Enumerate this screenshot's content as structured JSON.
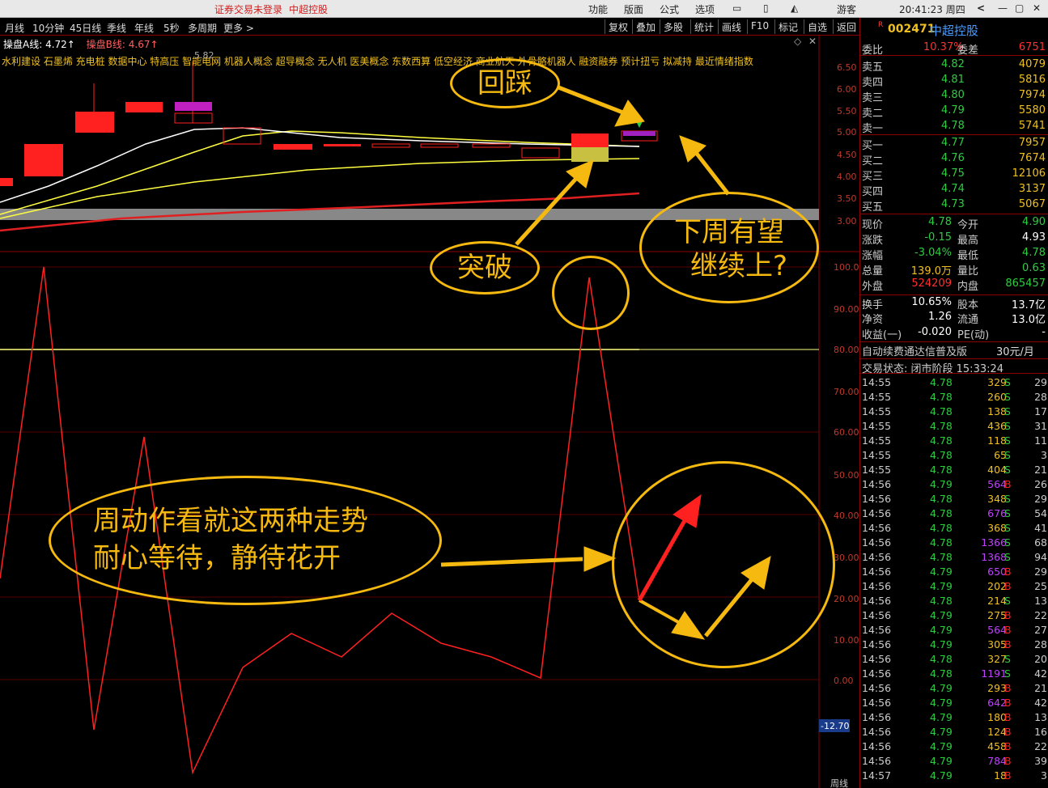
{
  "titlebar": {
    "status": "证券交易未登录",
    "stock_name": "中超控股",
    "menu": [
      "功能",
      "版面",
      "公式",
      "选项"
    ],
    "guest": "游客",
    "clock": "20:41:23 周四"
  },
  "toolbar": {
    "periods": [
      "月线",
      "10分钟",
      "45日线",
      "季线",
      "年线",
      "5秒",
      "多周期",
      "更多 >"
    ],
    "right_buttons": [
      "复权",
      "叠加",
      "多股",
      "统计",
      "画线",
      "F10",
      "标记",
      "自选",
      "返回"
    ]
  },
  "indicator_header": {
    "line_a": "操盘A线: 4.72↑",
    "line_b": "操盘B线: 4.67↑",
    "concepts": "水利建设 石墨烯 充电桩 数据中心 特高压 智能电网 机器人概念 超导概念 无人机 医美概念 东数西算 低空经济 商业航天 外骨骼机器人 融资融券 预计扭亏 拟减持 最近情绪指数",
    "price_tag": "5.82"
  },
  "price_axis": [
    "6.50",
    "6.00",
    "5.50",
    "5.00",
    "4.50",
    "4.00",
    "3.50",
    "3.00"
  ],
  "osc_axis": [
    "100.0",
    "90.00",
    "80.00",
    "70.00",
    "60.00",
    "50.00",
    "40.00",
    "30.00",
    "20.00",
    "10.00",
    "0.00"
  ],
  "osc_current": "-12.70",
  "corner_label": "周线",
  "annotations": {
    "huicai": "回踩",
    "tupo": "突破",
    "next_week_1": "下周有望",
    "next_week_2": "继续上?",
    "bottom_1": "周动作看就这两种走势",
    "bottom_2": "耐心等待，静待花开"
  },
  "quote": {
    "code": "002471",
    "name": "中超控股",
    "weibi_label": "委比",
    "weibi": "10.37%",
    "weicha_label": "委差",
    "weicha": "6751",
    "asks": [
      {
        "label": "卖五",
        "price": "4.82",
        "vol": "4079"
      },
      {
        "label": "卖四",
        "price": "4.81",
        "vol": "5816"
      },
      {
        "label": "卖三",
        "price": "4.80",
        "vol": "7974"
      },
      {
        "label": "卖二",
        "price": "4.79",
        "vol": "5580"
      },
      {
        "label": "卖一",
        "price": "4.78",
        "vol": "5741"
      }
    ],
    "bids": [
      {
        "label": "买一",
        "price": "4.77",
        "vol": "7957"
      },
      {
        "label": "买二",
        "price": "4.76",
        "vol": "7674"
      },
      {
        "label": "买三",
        "price": "4.75",
        "vol": "12106"
      },
      {
        "label": "买四",
        "price": "4.74",
        "vol": "3137"
      },
      {
        "label": "买五",
        "price": "4.73",
        "vol": "5067"
      }
    ],
    "stats": [
      {
        "l1": "现价",
        "v1": "4.78",
        "c1": "#2ecc40",
        "l2": "今开",
        "v2": "4.90",
        "c2": "#2ecc40"
      },
      {
        "l1": "涨跌",
        "v1": "-0.15",
        "c1": "#2ecc40",
        "l2": "最高",
        "v2": "4.93",
        "c2": "#ffffff"
      },
      {
        "l1": "涨幅",
        "v1": "-3.04%",
        "c1": "#2ecc40",
        "l2": "最低",
        "v2": "4.78",
        "c2": "#2ecc40"
      },
      {
        "l1": "总量",
        "v1": "139.0万",
        "c1": "#f0c020",
        "l2": "量比",
        "v2": "0.63",
        "c2": "#2ecc40"
      },
      {
        "l1": "外盘",
        "v1": "524209",
        "c1": "#ff3030",
        "l2": "内盘",
        "v2": "865457",
        "c2": "#2ecc40"
      },
      {
        "l1": "换手",
        "v1": "10.65%",
        "c1": "#ffffff",
        "l2": "股本",
        "v2": "13.7亿",
        "c2": "#ffffff"
      },
      {
        "l1": "净资",
        "v1": "1.26",
        "c1": "#ffffff",
        "l2": "流通",
        "v2": "13.0亿",
        "c2": "#ffffff"
      },
      {
        "l1": "收益(一)",
        "v1": "-0.020",
        "c1": "#ffffff",
        "l2": "PE(动)",
        "v2": "-",
        "c2": "#ffffff"
      }
    ],
    "banner": "自动续费通达信普及版",
    "banner_price": "30元/月",
    "trade_state": "交易状态: 闭市阶段 15:33:24",
    "ticks": [
      [
        "14:55",
        "4.78",
        "329",
        "S",
        "29"
      ],
      [
        "14:55",
        "4.78",
        "260",
        "S",
        "28"
      ],
      [
        "14:55",
        "4.78",
        "138",
        "S",
        "17"
      ],
      [
        "14:55",
        "4.78",
        "436",
        "S",
        "31"
      ],
      [
        "14:55",
        "4.78",
        "118",
        "S",
        "11"
      ],
      [
        "14:55",
        "4.78",
        "65",
        "S",
        "3"
      ],
      [
        "14:55",
        "4.78",
        "404",
        "S",
        "21"
      ],
      [
        "14:56",
        "4.79",
        "564",
        "B",
        "26"
      ],
      [
        "14:56",
        "4.78",
        "348",
        "S",
        "29"
      ],
      [
        "14:56",
        "4.78",
        "676",
        "S",
        "54"
      ],
      [
        "14:56",
        "4.78",
        "368",
        "S",
        "41"
      ],
      [
        "14:56",
        "4.78",
        "1366",
        "S",
        "68"
      ],
      [
        "14:56",
        "4.78",
        "1368",
        "S",
        "94"
      ],
      [
        "14:56",
        "4.79",
        "650",
        "B",
        "29"
      ],
      [
        "14:56",
        "4.79",
        "202",
        "B",
        "25"
      ],
      [
        "14:56",
        "4.78",
        "214",
        "S",
        "13"
      ],
      [
        "14:56",
        "4.79",
        "275",
        "B",
        "22"
      ],
      [
        "14:56",
        "4.79",
        "564",
        "B",
        "27"
      ],
      [
        "14:56",
        "4.79",
        "305",
        "B",
        "28"
      ],
      [
        "14:56",
        "4.78",
        "327",
        "S",
        "20"
      ],
      [
        "14:56",
        "4.78",
        "1191",
        "S",
        "42"
      ],
      [
        "14:56",
        "4.79",
        "293",
        "B",
        "21"
      ],
      [
        "14:56",
        "4.79",
        "642",
        "B",
        "42"
      ],
      [
        "14:56",
        "4.79",
        "180",
        "B",
        "13"
      ],
      [
        "14:56",
        "4.79",
        "124",
        "B",
        "16"
      ],
      [
        "14:56",
        "4.79",
        "458",
        "B",
        "22"
      ],
      [
        "14:56",
        "4.79",
        "784",
        "B",
        "39"
      ],
      [
        "14:57",
        "4.79",
        "18",
        "B",
        "3"
      ]
    ]
  },
  "colors": {
    "up": "#ff2020",
    "down": "#2ecc40",
    "accent": "#f5b90f",
    "ma_white": "#ffffff",
    "ma_yellow": "#ffff40",
    "ma_red": "#e02020"
  }
}
